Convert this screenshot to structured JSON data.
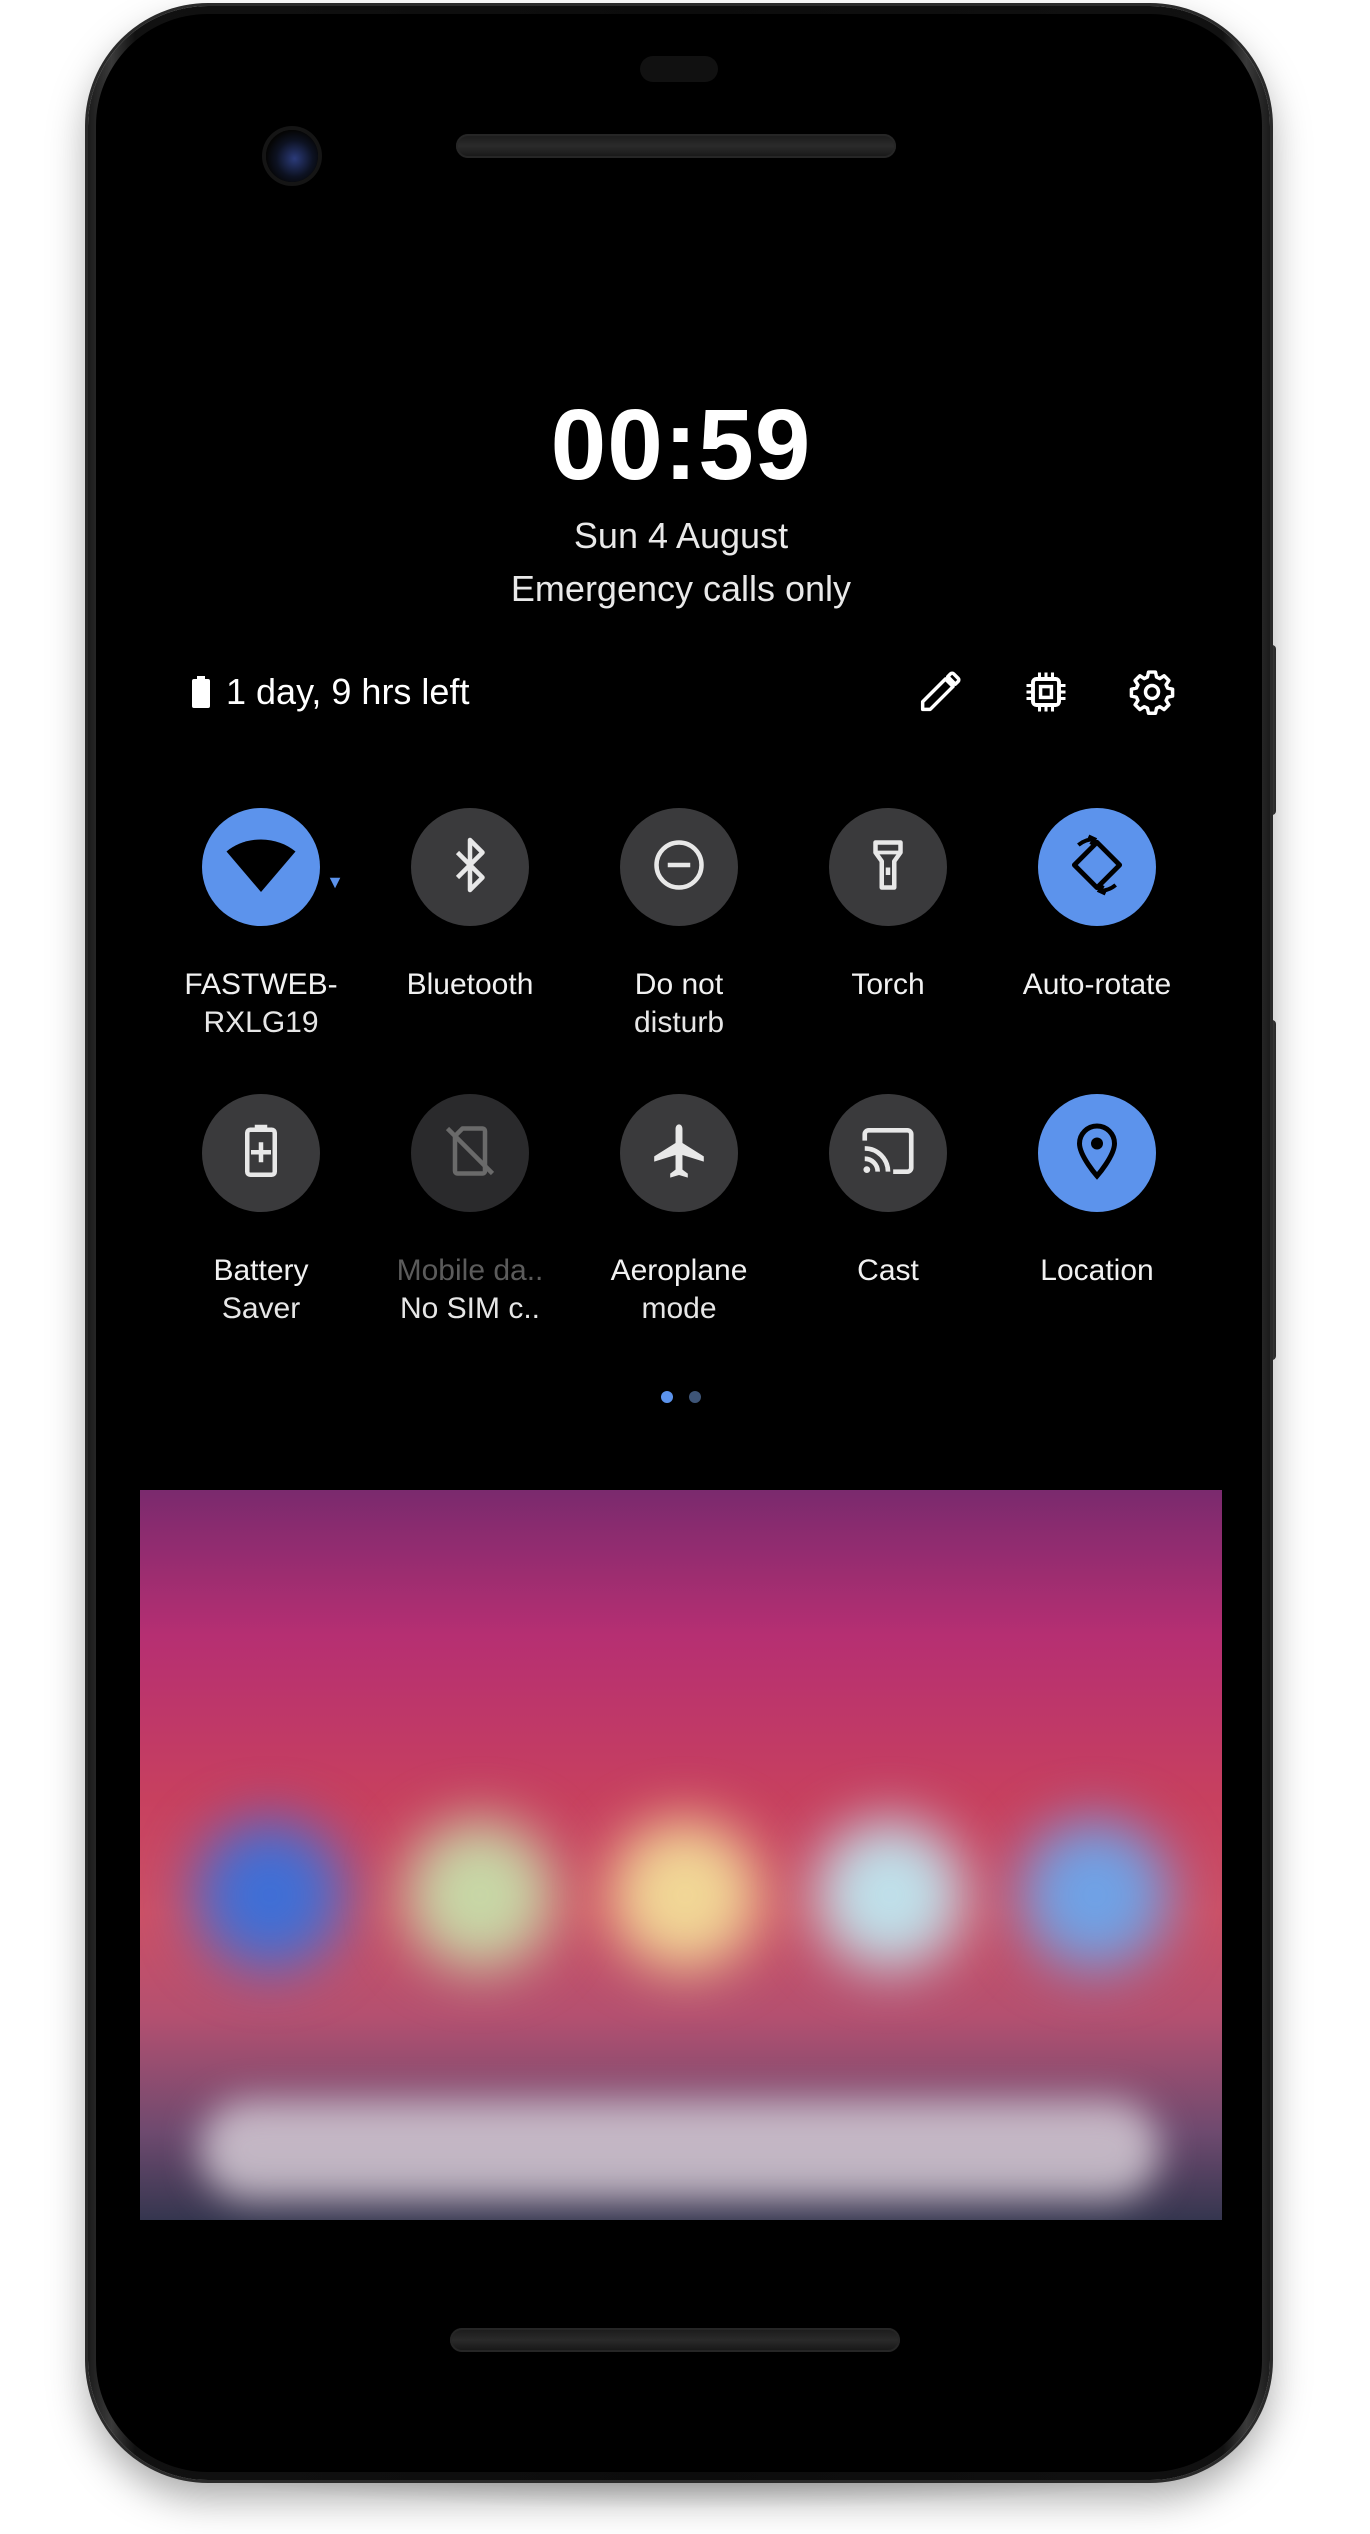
{
  "lockscreen": {
    "time": "00:59",
    "date": "Sun 4 August",
    "carrier_status": "Emergency calls only"
  },
  "status_row": {
    "battery_text": "1 day, 9 hrs left",
    "edit_icon": "pencil-icon",
    "device_icon": "chip-icon",
    "settings_icon": "gear-icon"
  },
  "quick_settings": {
    "active_color": "#5C93EC",
    "inactive_color": "#3A3A3C",
    "row1": [
      {
        "icon": "wifi-icon",
        "label_line1": "FASTWEB-",
        "label_line2": "RXLG19",
        "active": true
      },
      {
        "icon": "bluetooth-icon",
        "label_line1": "Bluetooth",
        "label_line2": "",
        "active": false
      },
      {
        "icon": "do-not-disturb-icon",
        "label_line1": "Do not",
        "label_line2": "disturb",
        "active": false
      },
      {
        "icon": "torch-icon",
        "label_line1": "Torch",
        "label_line2": "",
        "active": false
      },
      {
        "icon": "auto-rotate-icon",
        "label_line1": "Auto-rotate",
        "label_line2": "",
        "active": true
      }
    ],
    "row2": [
      {
        "icon": "battery-saver-icon",
        "label_line1": "Battery",
        "label_line2": "Saver",
        "active": false
      },
      {
        "icon": "no-sim-icon",
        "label_line1": "Mobile da..",
        "label_line2": "No SIM c..",
        "active": false
      },
      {
        "icon": "aeroplane-icon",
        "label_line1": "Aeroplane",
        "label_line2": "mode",
        "active": false
      },
      {
        "icon": "cast-icon",
        "label_line1": "Cast",
        "label_line2": "",
        "active": false
      },
      {
        "icon": "location-icon",
        "label_line1": "Location",
        "label_line2": "",
        "active": true
      }
    ],
    "pager": {
      "pages": 2,
      "current": 1,
      "active_dot_color": "#5C93EC",
      "inactive_dot_color": "#3E5577"
    }
  }
}
